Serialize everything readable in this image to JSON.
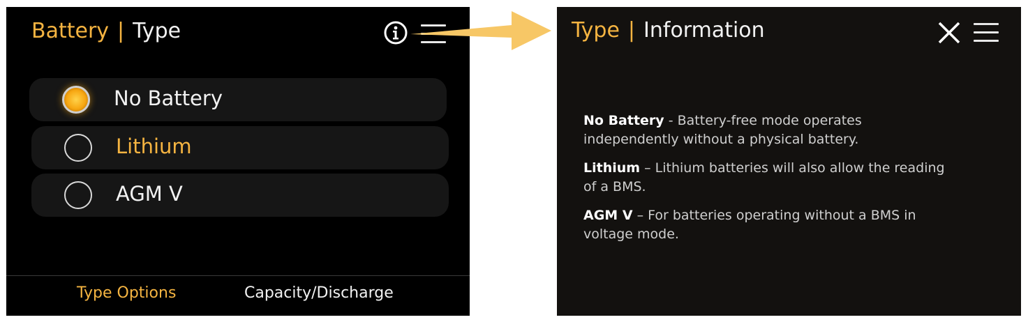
{
  "left_screen": {
    "title_accent": "Battery",
    "title_separator": "|",
    "title_plain": "Type",
    "options": [
      {
        "label": "No Battery",
        "selected": true
      },
      {
        "label": "Lithium",
        "selected": false
      },
      {
        "label": "AGM V",
        "selected": false
      }
    ],
    "footer": {
      "tab_active": "Type Options",
      "tab_inactive": "Capacity/Discharge"
    }
  },
  "right_screen": {
    "title_accent": "Type",
    "title_separator": "|",
    "title_plain": "Information",
    "entries": [
      {
        "term": "No Battery",
        "description": " - Battery-free mode operates independently without a physical battery."
      },
      {
        "term": "Lithium",
        "description": " – Lithium batteries will also allow the reading of a BMS."
      },
      {
        "term": "AGM V",
        "description": " – For batteries operating without a BMS in voltage mode."
      }
    ]
  },
  "colors": {
    "accent": "#f5b441",
    "arrow": "#f7c766",
    "left_background": "#000000",
    "right_background": "#13110f"
  },
  "icons": [
    "info-icon",
    "hamburger-menu-icon",
    "close-icon",
    "radio-button",
    "arrow"
  ]
}
